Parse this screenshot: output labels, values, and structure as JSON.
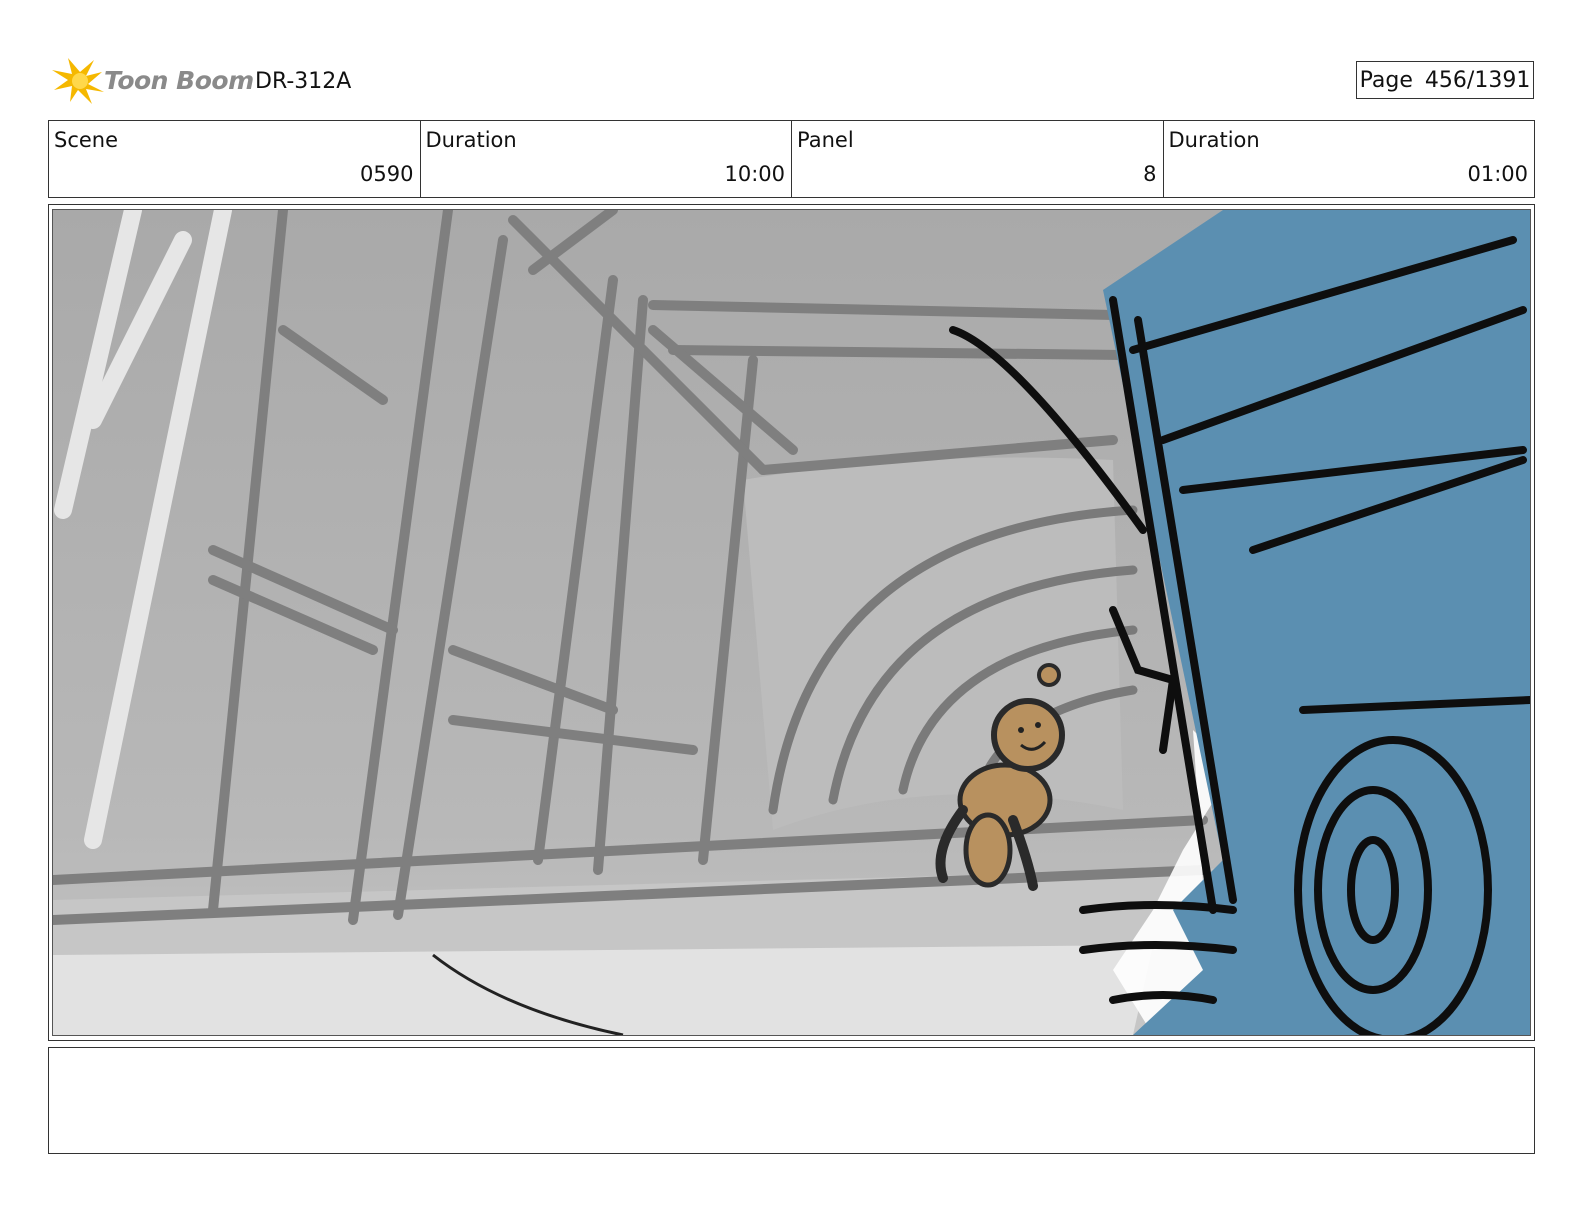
{
  "header": {
    "logo_text": "Toon Boom",
    "project_code": "DR-312A",
    "page_label": "Page",
    "page_number": "456/1391"
  },
  "info": {
    "scene_label": "Scene",
    "scene_value": "0590",
    "scene_duration_label": "Duration",
    "scene_duration_value": "10:00",
    "panel_label": "Panel",
    "panel_value": "8",
    "panel_duration_label": "Duration",
    "panel_duration_value": "01:00"
  },
  "colors": {
    "truck_blue": "#5b8fb1",
    "character_tan": "#b8915f",
    "background_gray": "#b3b3b3",
    "logo_yellow": "#f5b800"
  },
  "notes": {
    "text": ""
  }
}
